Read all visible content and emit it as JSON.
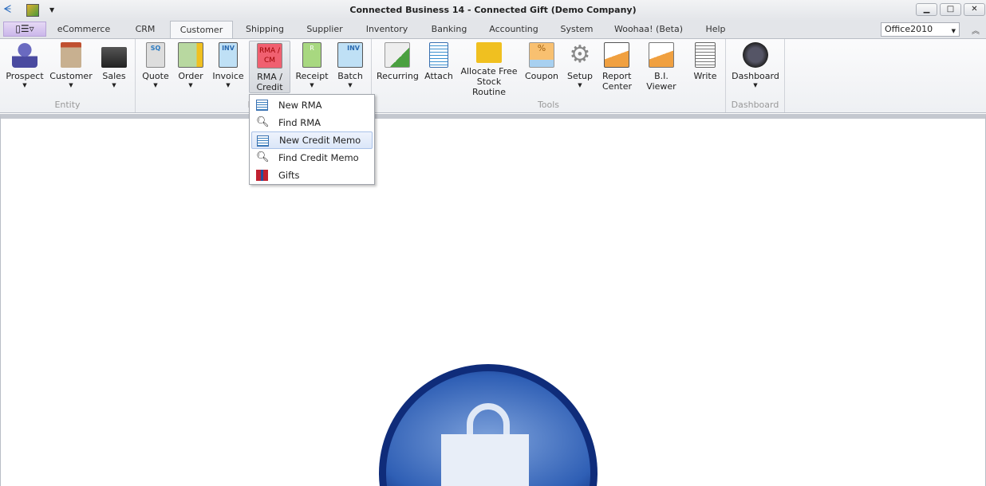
{
  "window": {
    "title": "Connected Business 14 - Connected Gift (Demo Company)",
    "minimize": "▁",
    "maximize": "□",
    "close": "✕"
  },
  "tabs": [
    "eCommerce",
    "CRM",
    "Customer",
    "Shipping",
    "Supplier",
    "Inventory",
    "Banking",
    "Accounting",
    "System",
    "Woohaa! (Beta)",
    "Help"
  ],
  "active_tab": "Customer",
  "theme_select": "Office2010",
  "ribbon": {
    "groups": [
      {
        "label": "Entity"
      },
      {
        "label": "Re"
      },
      {
        "label": "Tools"
      },
      {
        "label": "Dashboard"
      }
    ],
    "entity": [
      "Prospect",
      "Customer",
      "Sales"
    ],
    "records": [
      "Quote",
      "Order",
      "Invoice",
      "RMA / Credit",
      "Receipt",
      "Batch"
    ],
    "tools": [
      "Recurring",
      "Attach",
      "Allocate Free Stock Routine",
      "Coupon",
      "Setup",
      "Report Center",
      "B.I. Viewer",
      "Write"
    ],
    "dashboard": [
      "Dashboard"
    ],
    "icon_text": {
      "quote": "SQ",
      "invoice": "INV",
      "rma": "RMA / CM",
      "receipt": "R",
      "batch": "INV",
      "coupon": "%"
    }
  },
  "dropdown": {
    "items": [
      "New RMA",
      "Find RMA",
      "New Credit Memo",
      "Find Credit Memo",
      "Gifts"
    ],
    "highlighted": "New Credit Memo"
  }
}
